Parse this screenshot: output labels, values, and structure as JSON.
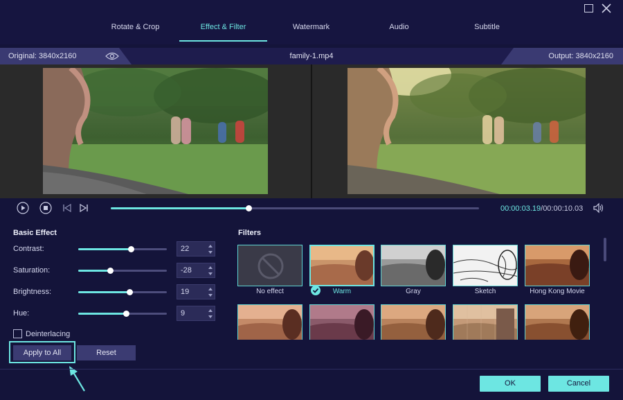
{
  "tabs": [
    {
      "label": "Rotate & Crop",
      "active": false
    },
    {
      "label": "Effect & Filter",
      "active": true
    },
    {
      "label": "Watermark",
      "active": false
    },
    {
      "label": "Audio",
      "active": false
    },
    {
      "label": "Subtitle",
      "active": false
    }
  ],
  "preview": {
    "original_label": "Original: 3840x2160",
    "filename": "family-1.mp4",
    "output_label": "Output: 3840x2160"
  },
  "playback": {
    "current_time": "00:00:03.19",
    "separator": "/",
    "total_time": "00:00:10.03",
    "progress_fraction": 0.374
  },
  "basic_effect": {
    "title": "Basic Effect",
    "items": [
      {
        "label": "Contrast:",
        "value": "22",
        "fraction": 0.59
      },
      {
        "label": "Saturation:",
        "value": "-28",
        "fraction": 0.36
      },
      {
        "label": "Brightness:",
        "value": "19",
        "fraction": 0.58
      },
      {
        "label": "Hue:",
        "value": "9",
        "fraction": 0.54
      }
    ],
    "deinterlacing_label": "Deinterlacing",
    "deinterlacing_checked": false,
    "apply_label": "Apply to All",
    "reset_label": "Reset"
  },
  "filters": {
    "title": "Filters",
    "selected": "Warm",
    "items": [
      {
        "name": "No effect",
        "style": "none"
      },
      {
        "name": "Warm",
        "style": "warm"
      },
      {
        "name": "Gray",
        "style": "gray"
      },
      {
        "name": "Sketch",
        "style": "sketch"
      },
      {
        "name": "Hong Kong Movie",
        "style": "hk"
      },
      {
        "name": "",
        "style": "warm"
      },
      {
        "name": "",
        "style": "purple"
      },
      {
        "name": "",
        "style": "warm"
      },
      {
        "name": "",
        "style": "mosaic"
      },
      {
        "name": "",
        "style": "hk"
      }
    ]
  },
  "footer": {
    "ok_label": "OK",
    "cancel_label": "Cancel"
  },
  "colors": {
    "accent": "#6de6e2",
    "background": "#14143a",
    "panel": "#3b3b72"
  }
}
